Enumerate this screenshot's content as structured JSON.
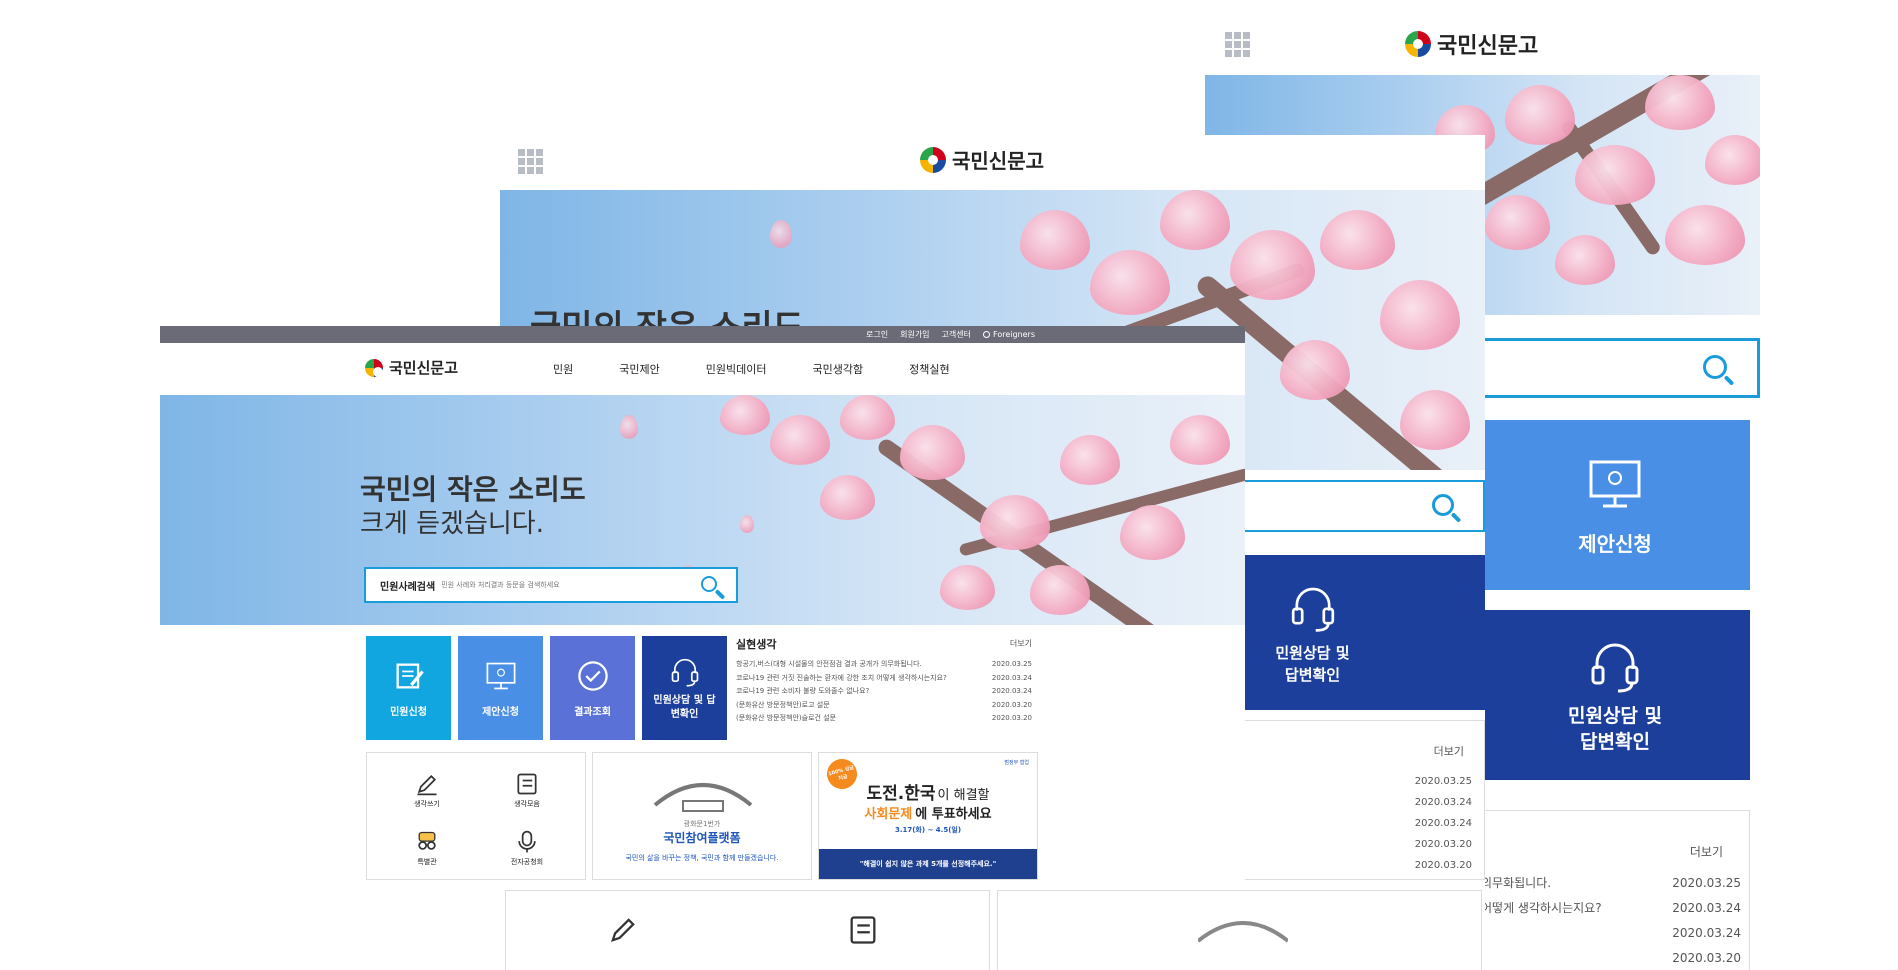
{
  "site": {
    "logo_text": "국민신문고"
  },
  "utility_bar": {
    "items": [
      "로그인",
      "회원가입",
      "고객센터",
      "Foreigners"
    ]
  },
  "gnb": {
    "items": [
      "민원",
      "국민제안",
      "민원빅데이터",
      "국민생각함",
      "정책실현"
    ]
  },
  "hero": {
    "title": "국민의 작은 소리도",
    "subtitle": "크게 듣겠습니다.",
    "search_label": "민원사례검색",
    "search_placeholder": "민원 사례와 처리결과 등문을 검색하세요"
  },
  "tiles": [
    {
      "label": "민원신청",
      "icon": "edit-document-icon",
      "color": "#12a6e0"
    },
    {
      "label": "제안신청",
      "icon": "monitor-bulb-icon",
      "color": "#4a8fe6"
    },
    {
      "label": "결과조회",
      "icon": "check-circle-icon",
      "color": "#5a72d8"
    },
    {
      "label": "민원상담 및 답변확인",
      "icon": "headset-icon",
      "color": "#1c3f9c"
    }
  ],
  "news": {
    "title": "실현생각",
    "more": "더보기",
    "items": [
      {
        "text": "항공기,버스(대형 시설물의 안전점검 결과 공개가 의무화됩니다.",
        "date": "2020.03.25"
      },
      {
        "text": "코로나19 관련 거짓 진술하는 환자에 강한 조치 어떻게 생각하시는지요?",
        "date": "2020.03.24"
      },
      {
        "text": "코로나19 관련 소비자 불량 도와줄수 없나요?",
        "date": "2020.03.24"
      },
      {
        "text": "(문화유산 방문정책안)로고 설문",
        "date": "2020.03.20"
      },
      {
        "text": "(문화유산 방문정책안)슬로건 설문",
        "date": "2020.03.20"
      }
    ]
  },
  "quick_links": [
    {
      "label": "생각쓰기",
      "icon": "pencil-icon"
    },
    {
      "label": "생각모음",
      "icon": "list-icon"
    },
    {
      "label": "특별관",
      "icon": "people-icon"
    },
    {
      "label": "전자공청회",
      "icon": "microphone-icon"
    }
  ],
  "promo1": {
    "top": "광화문1번가",
    "title": "국민참여플랫폼",
    "desc": "국민의 삶을 바꾸는 정책, 국민과 함께 만들겠습니다."
  },
  "promo2": {
    "badge": "100% 상금지급",
    "corner": "범정부 협업",
    "title_a": "도전.한국",
    "title_b": "이 해결할",
    "line2_a": "사회문제",
    "line2_b": "에 투표하세요",
    "dates": "3.17(화) ~ 4.5(일)",
    "footer": "\"해결이 쉽지 않은 과제 5개를 선정해주세요.\""
  },
  "mid_layer": {
    "consult_label_1": "민원상담 및",
    "consult_label_2": "답변확인",
    "more": "더보기",
    "dates": [
      "2020.03.25",
      "2020.03.24",
      "2020.03.24",
      "2020.03.20",
      "2020.03.20"
    ]
  },
  "back_layer": {
    "proposal_label": "제안신청",
    "consult_label_1": "민원상담 및",
    "consult_label_2": "답변확인",
    "more": "더보기",
    "rows": [
      {
        "text": "의무화됩니다.",
        "date": "2020.03.25"
      },
      {
        "text": "어떻게 생각하시는지요?",
        "date": "2020.03.24"
      },
      {
        "text": "",
        "date": "2020.03.24"
      },
      {
        "text": "",
        "date": "2020.03.20"
      }
    ]
  }
}
